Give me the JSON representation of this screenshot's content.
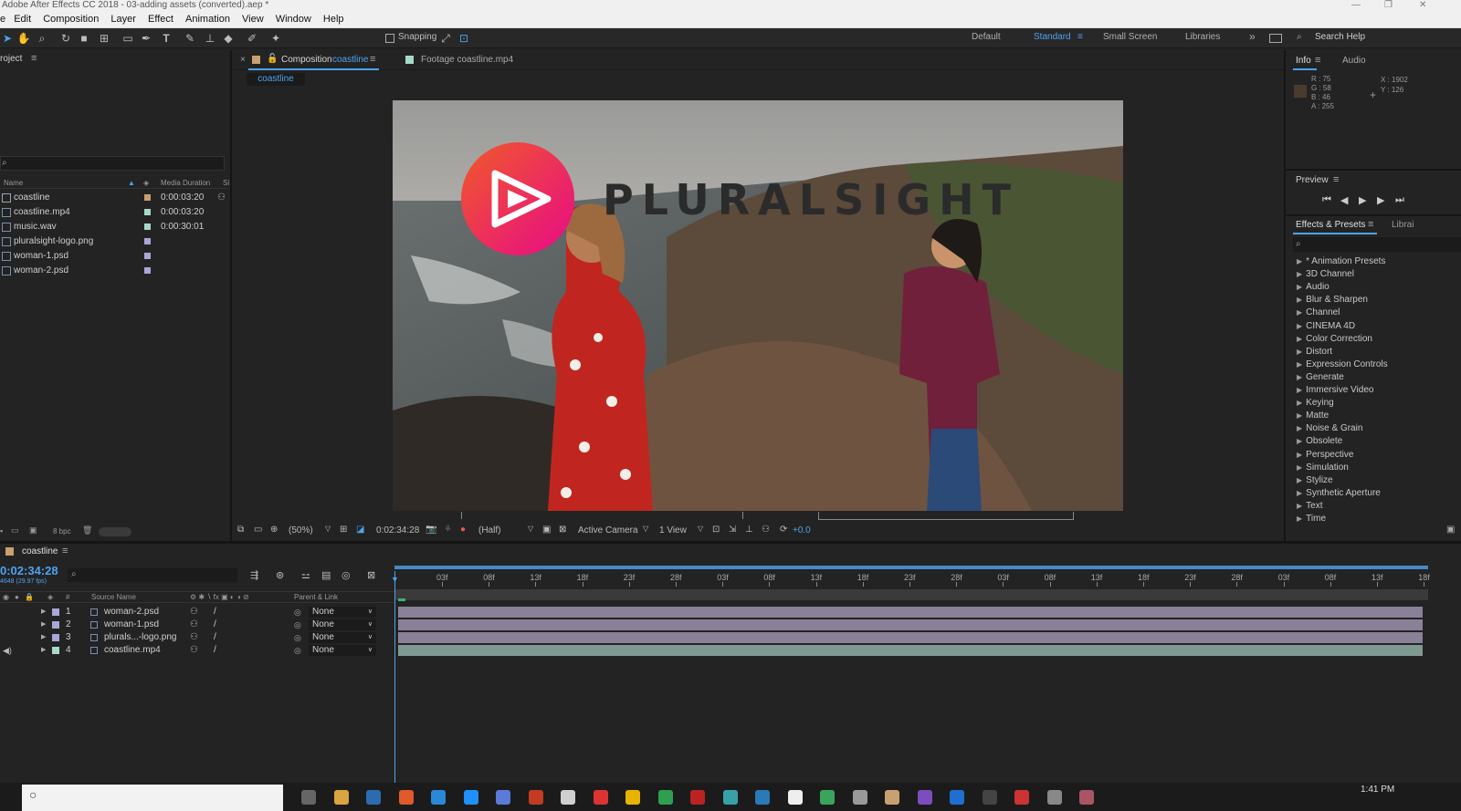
{
  "window": {
    "title": "Adobe After Effects CC 2018 - 03-adding assets (converted).aep *",
    "controls": [
      "—",
      "❐",
      "✕"
    ]
  },
  "menu": [
    "e",
    "Edit",
    "Composition",
    "Layer",
    "Effect",
    "Animation",
    "View",
    "Window",
    "Help"
  ],
  "toolbar": {
    "snapping_label": "Snapping",
    "workspaces": [
      "Default",
      "Standard",
      "Small Screen",
      "Libraries"
    ],
    "active_workspace": "Standard",
    "overflow": "»",
    "search_label": "Search Help"
  },
  "project": {
    "title": "roject",
    "columns": {
      "name": "Name",
      "duration": "Media Duration",
      "extra": "Si"
    },
    "items": [
      {
        "name": "coastline",
        "duration": "0:00:03:20",
        "label_color": "#c9a070",
        "type": "composition"
      },
      {
        "name": "coastline.mp4",
        "duration": "0:00:03:20",
        "label_color": "#a6d9c9",
        "type": "footage"
      },
      {
        "name": "music.wav",
        "duration": "0:00:30:01",
        "label_color": "#a6d9c9",
        "type": "audio"
      },
      {
        "name": "pluralsight-logo.png",
        "duration": "",
        "label_color": "#a9a6d9",
        "type": "image"
      },
      {
        "name": "woman-1.psd",
        "duration": "",
        "label_color": "#a9a6d9",
        "type": "image"
      },
      {
        "name": "woman-2.psd",
        "duration": "",
        "label_color": "#a9a6d9",
        "type": "image"
      }
    ],
    "bpc": "8 bpc"
  },
  "comp_panel": {
    "tab_prefix": "Composition",
    "tab_name": "coastline",
    "footage_tab": "Footage  coastline.mp4",
    "subtab": "coastline",
    "logo_text": "PLURALSIGHT",
    "bottom": {
      "zoom": "(50%)",
      "time": "0:02:34:28",
      "resolution": "(Half)",
      "camera": "Active Camera",
      "view": "1 View",
      "exposure": "+0.0"
    }
  },
  "info": {
    "tabs": [
      "Info",
      "Audio"
    ],
    "r": "R : 75",
    "g": "G : 58",
    "b": "B : 46",
    "a": "A : 255",
    "x": "X : 1902",
    "y": "Y : 126",
    "swatch": "#4b3a2e"
  },
  "preview": {
    "title": "Preview"
  },
  "effects": {
    "tabs": [
      "Effects & Presets",
      "Librai"
    ],
    "items": [
      "* Animation Presets",
      "3D Channel",
      "Audio",
      "Blur & Sharpen",
      "Channel",
      "CINEMA 4D",
      "Color Correction",
      "Distort",
      "Expression Controls",
      "Generate",
      "Immersive Video",
      "Keying",
      "Matte",
      "Noise & Grain",
      "Obsolete",
      "Perspective",
      "Simulation",
      "Stylize",
      "Synthetic Aperture",
      "Text",
      "Time"
    ]
  },
  "timeline": {
    "tab": "coastline",
    "timecode": "0:02:34:28",
    "fps": "4648 (29.97 fps)",
    "columns": {
      "num": "#",
      "source": "Source Name",
      "parent": "Parent & Link"
    },
    "ruler": [
      "03f",
      "08f",
      "13f",
      "18f",
      "23f",
      "28f",
      "03f",
      "08f",
      "13f",
      "18f",
      "23f",
      "28f",
      "03f",
      "08f",
      "13f",
      "18f",
      "23f",
      "28f",
      "03f",
      "08f",
      "13f",
      "18f"
    ],
    "layers": [
      {
        "num": "1",
        "name": "woman-2.psd",
        "parent": "None",
        "color": "#a9a6d9"
      },
      {
        "num": "2",
        "name": "woman-1.psd",
        "parent": "None",
        "color": "#a9a6d9"
      },
      {
        "num": "3",
        "name": "plurals...-logo.png",
        "parent": "None",
        "color": "#a9a6d9"
      },
      {
        "num": "4",
        "name": "coastline.mp4",
        "parent": "None",
        "color": "#a6d9c9"
      }
    ]
  },
  "taskbar": {
    "clock": "1:41 PM"
  },
  "colors": {
    "accent": "#4ea3f0",
    "logo_gradient_start": "#f05a28",
    "logo_gradient_end": "#e80a89"
  }
}
